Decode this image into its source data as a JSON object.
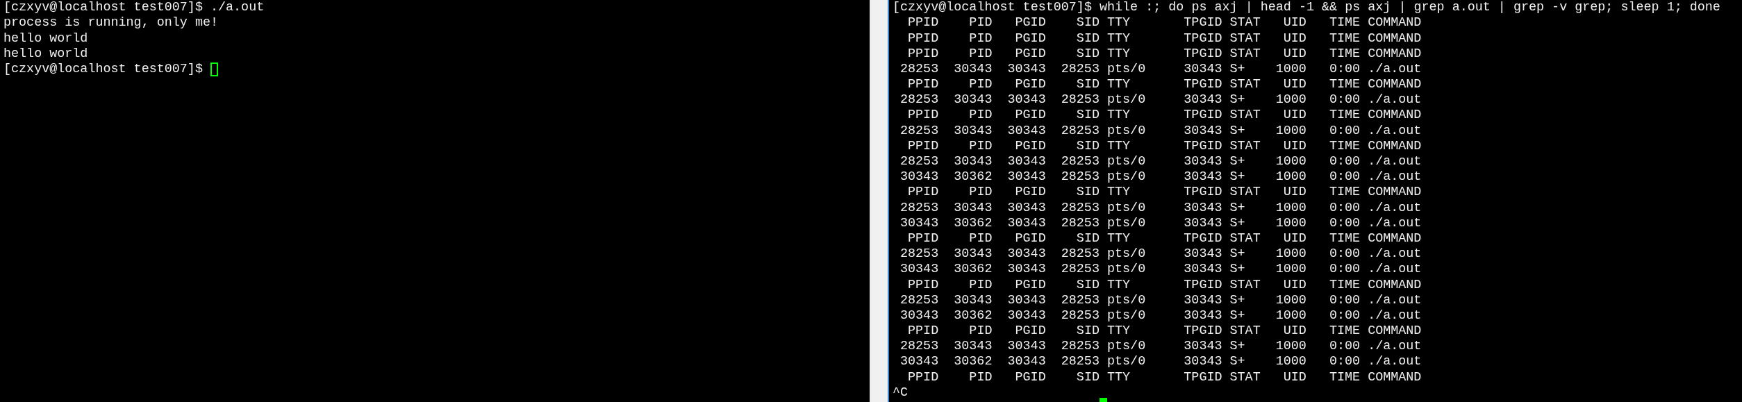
{
  "panes": [
    {
      "focused": false,
      "lines": [
        {
          "kind": "text",
          "text": "[czxyv@localhost test007]$ ./a.out"
        },
        {
          "kind": "text",
          "text": "process is running, only me!"
        },
        {
          "kind": "text",
          "text": "hello world"
        },
        {
          "kind": "text",
          "text": "hello world"
        },
        {
          "kind": "prompt",
          "text": "[czxyv@localhost test007]$"
        }
      ]
    },
    {
      "focused": true,
      "lines": [
        {
          "kind": "text",
          "text": "[czxyv@localhost test007]$ while :; do ps axj | head -1 && ps axj | grep a.out | grep -v grep; sleep 1; done"
        },
        {
          "kind": "header",
          "cells": [
            "PPID",
            "PID",
            "PGID",
            "SID",
            "TTY",
            "TPGID",
            "STAT",
            "UID",
            "TIME",
            "COMMAND"
          ]
        },
        {
          "kind": "header",
          "cells": [
            "PPID",
            "PID",
            "PGID",
            "SID",
            "TTY",
            "TPGID",
            "STAT",
            "UID",
            "TIME",
            "COMMAND"
          ]
        },
        {
          "kind": "header",
          "cells": [
            "PPID",
            "PID",
            "PGID",
            "SID",
            "TTY",
            "TPGID",
            "STAT",
            "UID",
            "TIME",
            "COMMAND"
          ]
        },
        {
          "kind": "row",
          "cells": [
            "28253",
            "30343",
            "30343",
            "28253",
            "pts/0",
            "30343",
            "S+",
            "1000",
            "0:00",
            "./a.out"
          ]
        },
        {
          "kind": "header",
          "cells": [
            "PPID",
            "PID",
            "PGID",
            "SID",
            "TTY",
            "TPGID",
            "STAT",
            "UID",
            "TIME",
            "COMMAND"
          ]
        },
        {
          "kind": "row",
          "cells": [
            "28253",
            "30343",
            "30343",
            "28253",
            "pts/0",
            "30343",
            "S+",
            "1000",
            "0:00",
            "./a.out"
          ]
        },
        {
          "kind": "header",
          "cells": [
            "PPID",
            "PID",
            "PGID",
            "SID",
            "TTY",
            "TPGID",
            "STAT",
            "UID",
            "TIME",
            "COMMAND"
          ]
        },
        {
          "kind": "row",
          "cells": [
            "28253",
            "30343",
            "30343",
            "28253",
            "pts/0",
            "30343",
            "S+",
            "1000",
            "0:00",
            "./a.out"
          ]
        },
        {
          "kind": "header",
          "cells": [
            "PPID",
            "PID",
            "PGID",
            "SID",
            "TTY",
            "TPGID",
            "STAT",
            "UID",
            "TIME",
            "COMMAND"
          ]
        },
        {
          "kind": "row",
          "cells": [
            "28253",
            "30343",
            "30343",
            "28253",
            "pts/0",
            "30343",
            "S+",
            "1000",
            "0:00",
            "./a.out"
          ]
        },
        {
          "kind": "row",
          "cells": [
            "30343",
            "30362",
            "30343",
            "28253",
            "pts/0",
            "30343",
            "S+",
            "1000",
            "0:00",
            "./a.out"
          ]
        },
        {
          "kind": "header",
          "cells": [
            "PPID",
            "PID",
            "PGID",
            "SID",
            "TTY",
            "TPGID",
            "STAT",
            "UID",
            "TIME",
            "COMMAND"
          ]
        },
        {
          "kind": "row",
          "cells": [
            "28253",
            "30343",
            "30343",
            "28253",
            "pts/0",
            "30343",
            "S+",
            "1000",
            "0:00",
            "./a.out"
          ]
        },
        {
          "kind": "row",
          "cells": [
            "30343",
            "30362",
            "30343",
            "28253",
            "pts/0",
            "30343",
            "S+",
            "1000",
            "0:00",
            "./a.out"
          ]
        },
        {
          "kind": "header",
          "cells": [
            "PPID",
            "PID",
            "PGID",
            "SID",
            "TTY",
            "TPGID",
            "STAT",
            "UID",
            "TIME",
            "COMMAND"
          ]
        },
        {
          "kind": "row",
          "cells": [
            "28253",
            "30343",
            "30343",
            "28253",
            "pts/0",
            "30343",
            "S+",
            "1000",
            "0:00",
            "./a.out"
          ]
        },
        {
          "kind": "row",
          "cells": [
            "30343",
            "30362",
            "30343",
            "28253",
            "pts/0",
            "30343",
            "S+",
            "1000",
            "0:00",
            "./a.out"
          ]
        },
        {
          "kind": "header",
          "cells": [
            "PPID",
            "PID",
            "PGID",
            "SID",
            "TTY",
            "TPGID",
            "STAT",
            "UID",
            "TIME",
            "COMMAND"
          ]
        },
        {
          "kind": "row",
          "cells": [
            "28253",
            "30343",
            "30343",
            "28253",
            "pts/0",
            "30343",
            "S+",
            "1000",
            "0:00",
            "./a.out"
          ]
        },
        {
          "kind": "row",
          "cells": [
            "30343",
            "30362",
            "30343",
            "28253",
            "pts/0",
            "30343",
            "S+",
            "1000",
            "0:00",
            "./a.out"
          ]
        },
        {
          "kind": "header",
          "cells": [
            "PPID",
            "PID",
            "PGID",
            "SID",
            "TTY",
            "TPGID",
            "STAT",
            "UID",
            "TIME",
            "COMMAND"
          ]
        },
        {
          "kind": "row",
          "cells": [
            "28253",
            "30343",
            "30343",
            "28253",
            "pts/0",
            "30343",
            "S+",
            "1000",
            "0:00",
            "./a.out"
          ]
        },
        {
          "kind": "row",
          "cells": [
            "30343",
            "30362",
            "30343",
            "28253",
            "pts/0",
            "30343",
            "S+",
            "1000",
            "0:00",
            "./a.out"
          ]
        },
        {
          "kind": "header",
          "cells": [
            "PPID",
            "PID",
            "PGID",
            "SID",
            "TTY",
            "TPGID",
            "STAT",
            "UID",
            "TIME",
            "COMMAND"
          ]
        },
        {
          "kind": "text",
          "text": "^C"
        },
        {
          "kind": "cursor"
        }
      ]
    }
  ]
}
